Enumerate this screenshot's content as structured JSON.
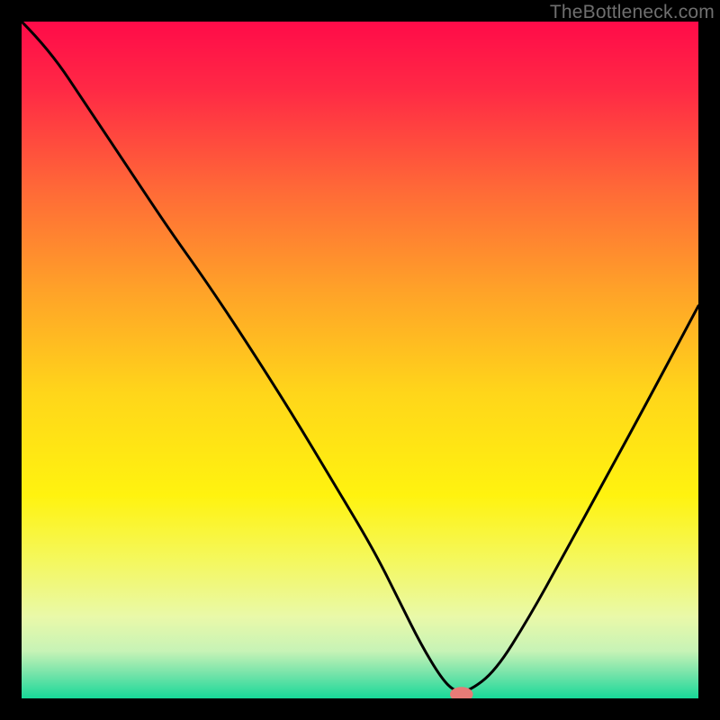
{
  "watermark": "TheBottleneck.com",
  "chart_data": {
    "type": "line",
    "title": "",
    "xlabel": "",
    "ylabel": "",
    "xlim": [
      0,
      100
    ],
    "ylim": [
      0,
      100
    ],
    "background_gradient_stops": [
      {
        "offset": 0.0,
        "color": "#ff0b49"
      },
      {
        "offset": 0.1,
        "color": "#ff2945"
      },
      {
        "offset": 0.25,
        "color": "#ff6a37"
      },
      {
        "offset": 0.4,
        "color": "#ffa328"
      },
      {
        "offset": 0.55,
        "color": "#ffd61a"
      },
      {
        "offset": 0.7,
        "color": "#fff30f"
      },
      {
        "offset": 0.8,
        "color": "#f4f861"
      },
      {
        "offset": 0.88,
        "color": "#e9f9a9"
      },
      {
        "offset": 0.93,
        "color": "#c7f3b6"
      },
      {
        "offset": 0.965,
        "color": "#72e3a9"
      },
      {
        "offset": 1.0,
        "color": "#17d998"
      }
    ],
    "series": [
      {
        "name": "bottleneck-curve",
        "color": "#000000",
        "stroke_width": 3,
        "x": [
          0,
          4,
          10,
          16,
          22,
          27,
          33,
          40,
          46,
          52,
          56,
          59,
          62,
          64,
          66,
          70,
          75,
          80,
          86,
          92,
          100
        ],
        "y": [
          100,
          96,
          87,
          78,
          69,
          62,
          53,
          42,
          32,
          22,
          14,
          8,
          3,
          1,
          1,
          4,
          12,
          21,
          32,
          43,
          58
        ]
      }
    ],
    "marker": {
      "name": "optimal-point",
      "x": 65,
      "y": 0.6,
      "rx": 1.7,
      "ry": 1.1,
      "fill": "#e77b77"
    }
  }
}
